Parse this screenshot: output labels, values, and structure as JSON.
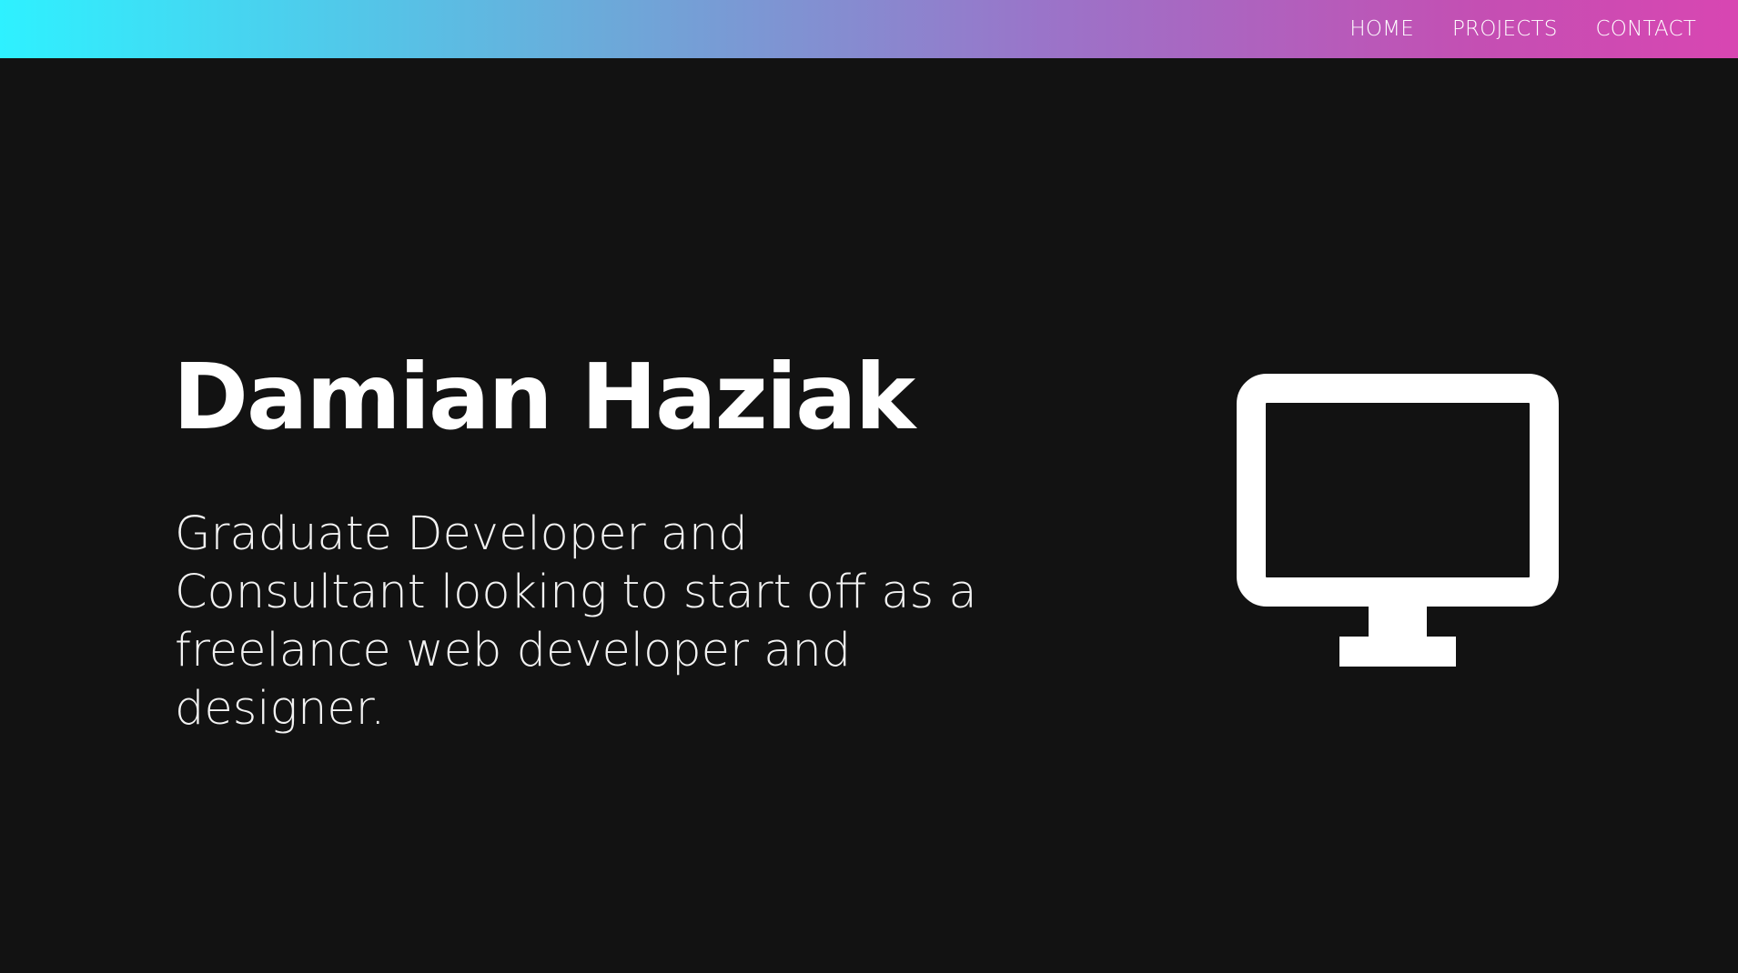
{
  "nav": {
    "items": [
      {
        "label": "HOME"
      },
      {
        "label": "PROJECTS"
      },
      {
        "label": "CONTACT"
      }
    ],
    "gradient_colors": [
      "#2ef1ff",
      "#d846b2"
    ]
  },
  "hero": {
    "title": "Damian Haziak",
    "subtitle": "Graduate Developer and Consultant looking to start off as a freelance web developer and designer.",
    "icon": "monitor-icon"
  },
  "colors": {
    "background": "#121212",
    "text": "#ffffff"
  }
}
